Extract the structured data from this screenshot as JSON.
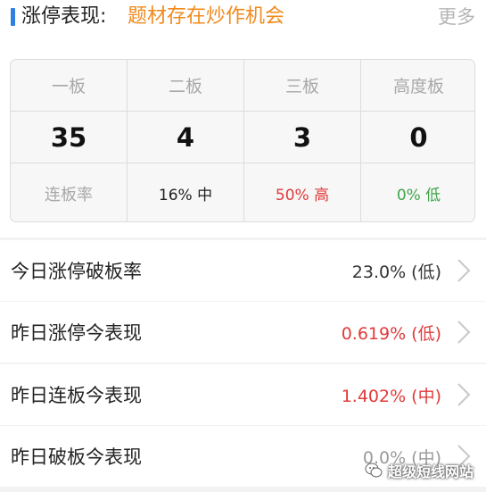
{
  "header": {
    "title": "涨停表现:",
    "subtitle": "题材存在炒作机会",
    "more_label": "更多"
  },
  "stats": {
    "columns": [
      {
        "label": "一板",
        "count": "35"
      },
      {
        "label": "二板",
        "count": "4"
      },
      {
        "label": "三板",
        "count": "3"
      },
      {
        "label": "高度板",
        "count": "0"
      }
    ],
    "rate_label": "连板率",
    "rates": [
      {
        "text": "16% 中",
        "color": "#222222"
      },
      {
        "text": "50% 高",
        "color": "#e03a3a"
      },
      {
        "text": "0% 低",
        "color": "#3fa54a"
      }
    ]
  },
  "rows": [
    {
      "label": "今日涨停破板率",
      "value": "23.0% (低)",
      "value_color": "#333333"
    },
    {
      "label": "昨日涨停今表现",
      "value": "0.619% (低)",
      "value_color": "#e03a3a"
    },
    {
      "label": "昨日连板今表现",
      "value": "1.402% (中)",
      "value_color": "#e03a3a"
    },
    {
      "label": "昨日破板今表现",
      "value": "0.0% (中)",
      "value_color": "#9a9a9a"
    }
  ],
  "watermark": {
    "text": "超级短线网站",
    "icon": "wechat-icon"
  }
}
